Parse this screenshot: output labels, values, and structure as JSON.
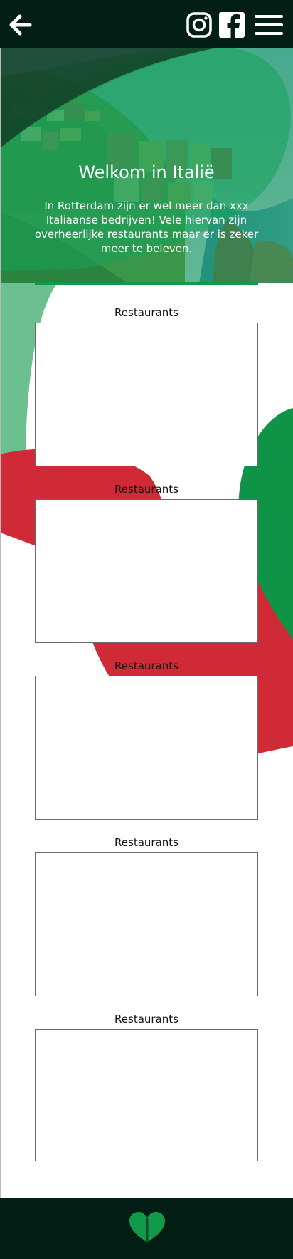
{
  "header": {
    "back_icon": "arrow-left-icon",
    "instagram_icon": "instagram-icon",
    "facebook_icon": "facebook-icon",
    "menu_icon": "hamburger-menu-icon"
  },
  "hero": {
    "title": "Welkom in Italië",
    "body_lines": [
      "In Rotterdam zijn er wel meer dan xxx",
      "Italiaanse bedrijven! Vele hiervan zijn",
      "overheerlijke restaurants maar er is zeker",
      "meer te beleven."
    ]
  },
  "sections": [
    {
      "label": "Restaurants"
    },
    {
      "label": "Restaurants"
    },
    {
      "label": "Restaurants"
    },
    {
      "label": "Restaurants"
    },
    {
      "label": "Restaurants"
    }
  ],
  "footer": {
    "heart_icon": "heart-icon"
  },
  "colors": {
    "dark": "#031e14",
    "green": "#0f9447",
    "light_green": "#6cc08f",
    "red": "#cf2a36",
    "white": "#ffffff"
  }
}
